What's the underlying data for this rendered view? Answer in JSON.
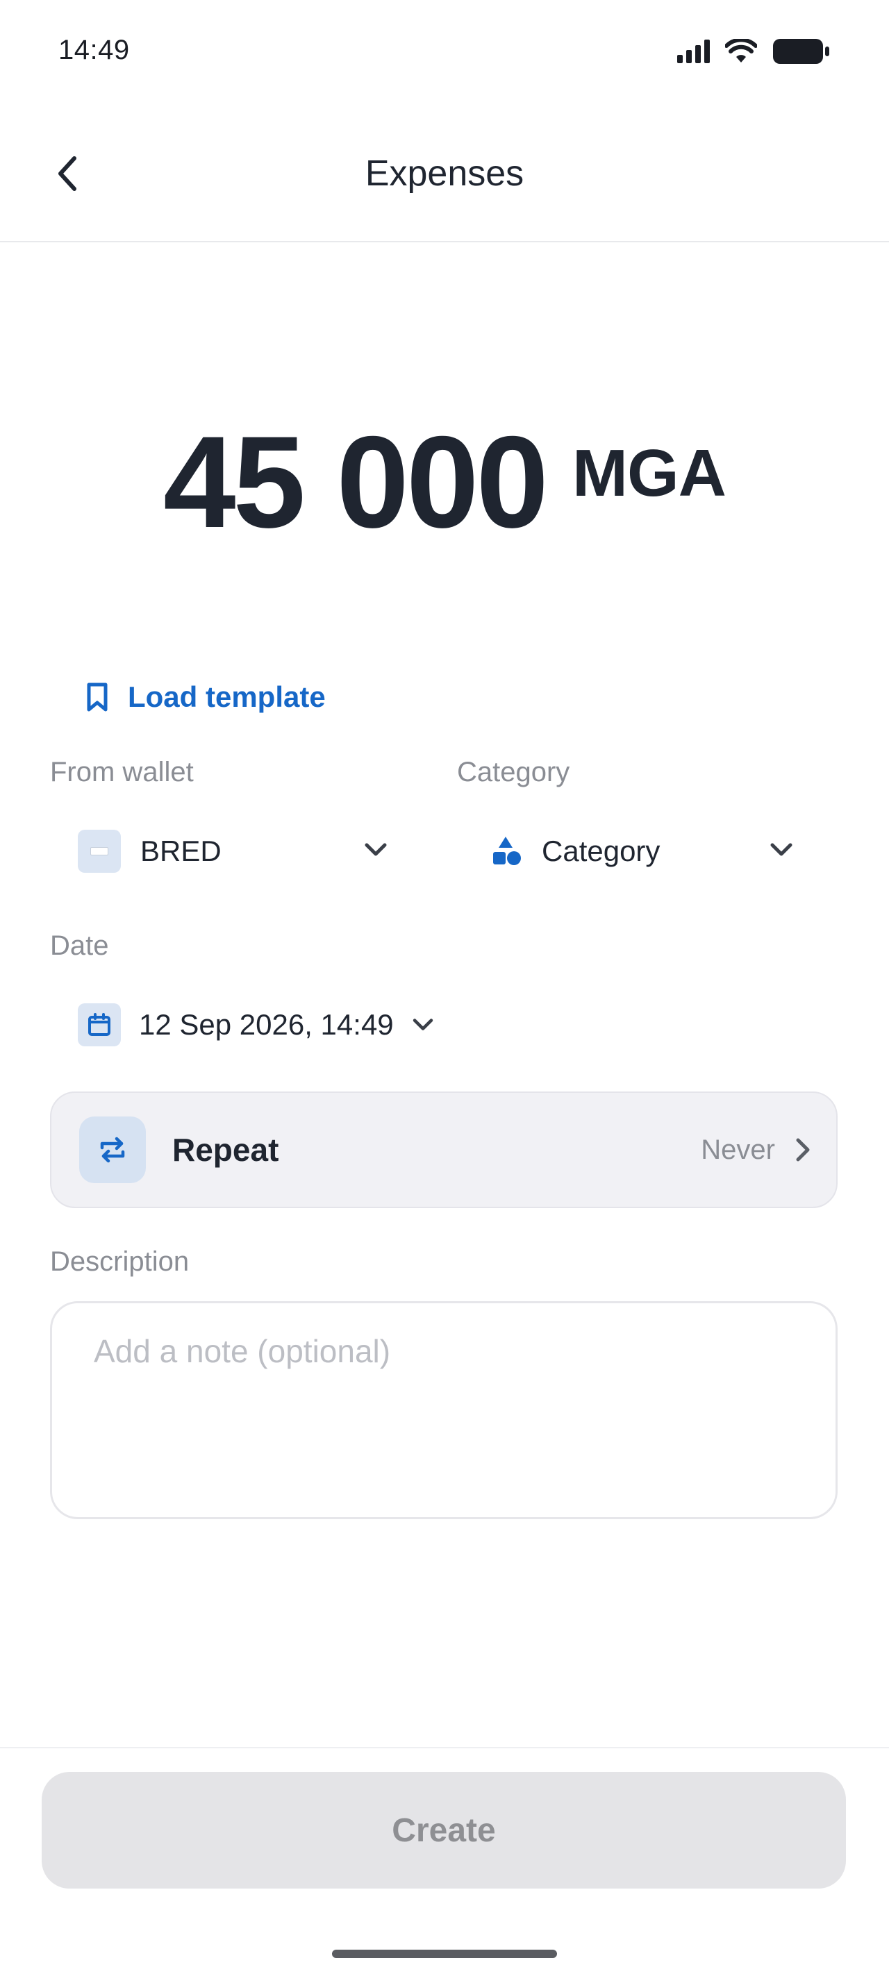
{
  "status_bar": {
    "time": "14:49"
  },
  "header": {
    "title": "Expenses",
    "back_icon": "chevron-left-icon"
  },
  "amount": {
    "value": "45 000",
    "currency": "MGA"
  },
  "template": {
    "label": "Load template",
    "icon": "bookmark-icon"
  },
  "from_wallet": {
    "label": "From wallet",
    "value": "BRED"
  },
  "category": {
    "label": "Category",
    "value": "Category",
    "icon": "shapes-icon"
  },
  "date": {
    "label": "Date",
    "value": "12 Sep 2026, 14:49",
    "icon": "calendar-icon"
  },
  "repeat": {
    "label": "Repeat",
    "value": "Never",
    "icon": "repeat-icon"
  },
  "description": {
    "label": "Description",
    "placeholder": "Add a note (optional)",
    "value": ""
  },
  "actions": {
    "create_label": "Create"
  },
  "colors": {
    "accent": "#1667c7",
    "text_primary": "#1f2530",
    "text_secondary": "#8a8d94",
    "button_disabled_bg": "#e4e4e7"
  }
}
